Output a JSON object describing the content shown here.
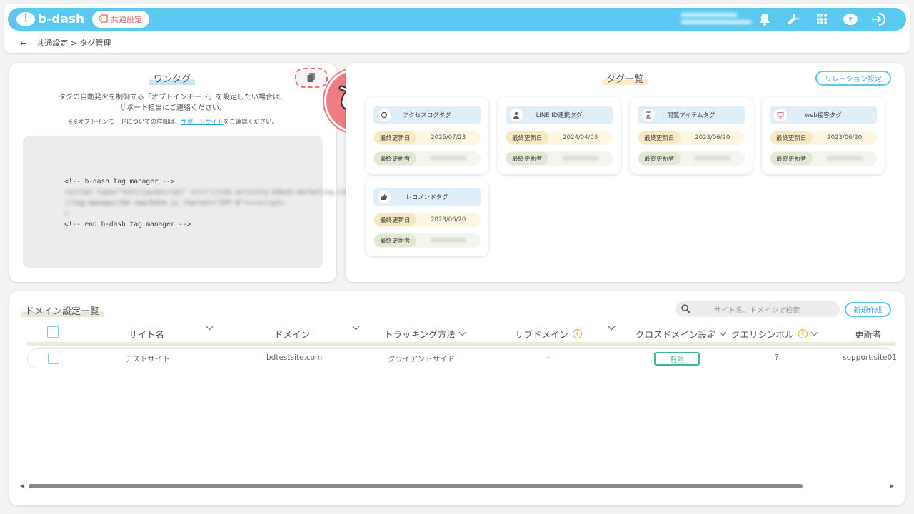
{
  "header": {
    "logo_text": "b-dash",
    "common_settings_label": "共通設定"
  },
  "breadcrumb": {
    "back_label": "←",
    "path": "共通設定 > タグ管理"
  },
  "onetag": {
    "title": "ワンタグ",
    "desc_line1": "タグの自動発火を制御する「オプトインモード」を設定したい場合は、",
    "desc_line2": "サポート担当にご連絡ください。",
    "note_prefix": "※※オプトインモードについての詳細は、",
    "note_link": "サポートサイト",
    "note_suffix": "をご確認ください。",
    "code_start": "<!-- b-dash tag manager -->",
    "code_end": "<!-- end b-dash tag manager -->"
  },
  "taglist": {
    "title": "タグ一覧",
    "relation_button": "リレーション設定",
    "date_label": "最終更新日",
    "user_label": "最終更新者",
    "cards": [
      {
        "name": "アクセスログタグ",
        "icon": "access-log-icon",
        "date": "2025/07/23"
      },
      {
        "name": "LINE ID連携タグ",
        "icon": "person-icon",
        "date": "2024/04/03"
      },
      {
        "name": "閲覧アイテムタグ",
        "icon": "document-icon",
        "date": "2023/06/20"
      },
      {
        "name": "web接客タグ",
        "icon": "monitor-icon",
        "date": "2023/06/20"
      },
      {
        "name": "レコメンドタグ",
        "icon": "thumbs-up-icon",
        "date": "2023/06/20"
      }
    ]
  },
  "domain": {
    "title": "ドメイン設定一覧",
    "search_placeholder": "サイト名、ドメインで検索",
    "new_button": "新規作成",
    "columns": {
      "site_name": "サイト名",
      "domain": "ドメイン",
      "tracking": "トラッキング方法",
      "subdomain": "サブドメイン",
      "crossdomain": "クロスドメイン設定",
      "query_symbol": "クエリシンボル",
      "updater": "更新者"
    },
    "rows": [
      {
        "site_name": "テストサイト",
        "domain": "bdtestsite.com",
        "tracking": "クライアントサイド",
        "subdomain": "-",
        "crossdomain": "有効",
        "query_symbol": "?",
        "updater": "support.site01"
      }
    ]
  },
  "colors": {
    "brand": "#5ac8f0",
    "accent_red": "#f07b82",
    "valid_green": "#3fb99a"
  }
}
